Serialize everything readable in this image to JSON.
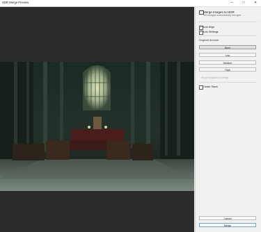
{
  "window": {
    "title": "HDR Merge Preview",
    "minimize": "–",
    "maximize": "□",
    "close": "✕"
  },
  "panel": {
    "title": "Merge Images to HDR",
    "subtitle": "4/5 images successfully merged",
    "options": [
      {
        "label": "Auto Align",
        "checked": true
      },
      {
        "label": "Auto Settings",
        "checked": true
      }
    ],
    "deghost": {
      "label": "Deghost Amount",
      "buttons": [
        "None",
        "Low",
        "Medium",
        "High"
      ],
      "selected": "None",
      "overlay": {
        "label": "Show Deghost Overlay",
        "checked": false,
        "enabled": false
      }
    },
    "create_stack": {
      "label": "Create Stack",
      "checked": false
    },
    "cancel": "Cancel",
    "merge": "Merge"
  },
  "colors": {
    "accent": "#6aa5da",
    "preview_bg": "#2b2b2b",
    "panel_bg": "#f1f1f1"
  }
}
